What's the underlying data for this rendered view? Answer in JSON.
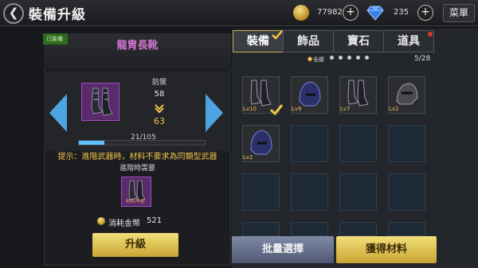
{
  "header": {
    "title": "裝備升級",
    "back_icon": "back-arrow-icon",
    "menu_label": "菜單"
  },
  "resources": {
    "gold": "77982",
    "gems": "235"
  },
  "item": {
    "equipped_tag": "已裝備",
    "name": "龍胄長靴",
    "name_color": "#d277d4",
    "stat_label": "防禦",
    "stat_current": "58",
    "stat_next": "63",
    "exp_text": "21/105",
    "exp_fraction": 0.2
  },
  "upgrade": {
    "tip": "提示：進階武器時，材料不要求為同類型武器",
    "need_label": "進階時需要",
    "material_label": "材料不足",
    "cost_label": "消耗金幣",
    "cost_value": "521",
    "button_label": "升級"
  },
  "tabs": [
    {
      "label": "裝備",
      "active": true
    },
    {
      "label": "飾品",
      "active": false
    },
    {
      "label": "寶石",
      "active": false
    },
    {
      "label": "道具",
      "active": false
    }
  ],
  "filter": {
    "all_label": "全部",
    "page_count": "5/28"
  },
  "inventory": [
    {
      "level": "Lv10",
      "icon": "boots-icon",
      "selected": true
    },
    {
      "level": "Lv9",
      "icon": "helmet-icon",
      "selected": false
    },
    {
      "level": "Lv7",
      "icon": "boots-icon",
      "selected": false
    },
    {
      "level": "Lv2",
      "icon": "helmet-icon",
      "selected": false
    },
    {
      "level": "Lv2",
      "icon": "helmet-icon",
      "selected": false
    }
  ],
  "actions": {
    "batch_select": "批量選擇",
    "get_materials": "獲得材料"
  },
  "colors": {
    "gold": "#f0c24a",
    "accent_blue": "#4da4e2",
    "epic_purple": "#a14fc0",
    "button_gold": "#c9a532"
  }
}
